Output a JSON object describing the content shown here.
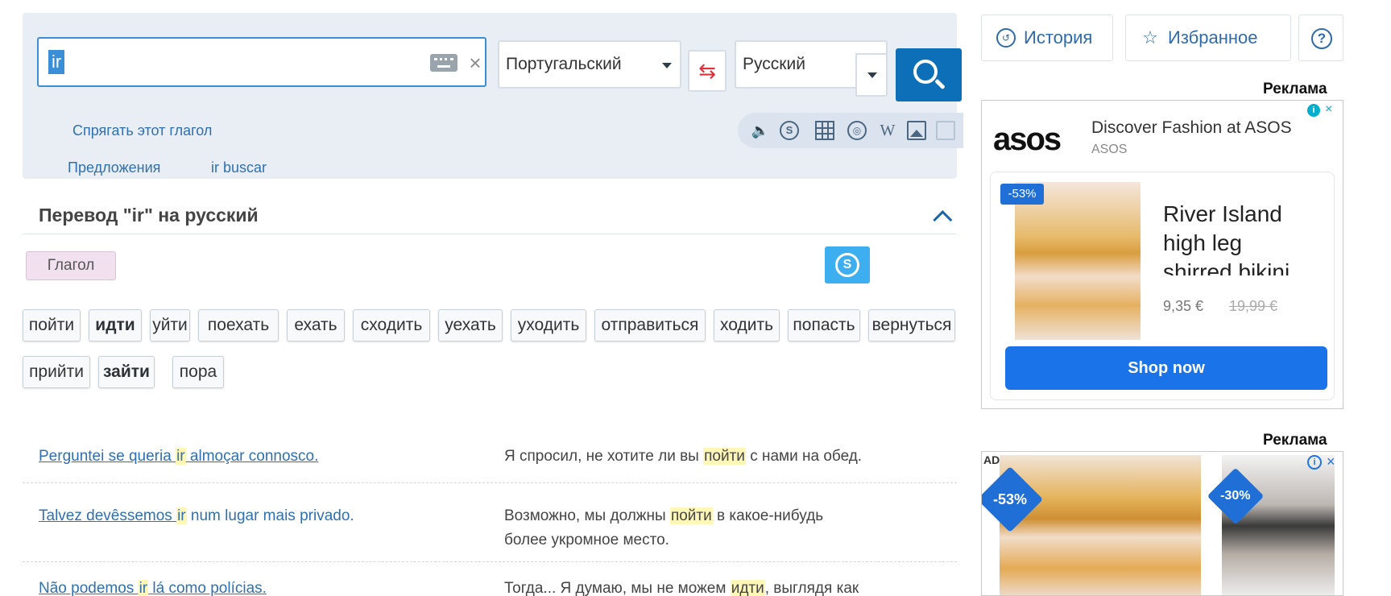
{
  "search": {
    "typed_text": "ir",
    "input_value": "",
    "source_language": "Португальский",
    "target_language": "Русский",
    "conjugate_link": "Спрягать этот глагол",
    "suggestions": [
      "Предложения",
      "ir buscar"
    ]
  },
  "icons": {
    "swap": "⇆",
    "clear": "×",
    "speaker": "🔈",
    "skype": "S",
    "globe": "◎",
    "wiki": "W",
    "history": "↺",
    "favorites": "☆",
    "help": "?"
  },
  "header": {
    "history_label": "История",
    "favorites_label": "Избранное"
  },
  "translation": {
    "title": "Перевод \"ir\" на русский",
    "part_of_speech": "Глагол",
    "words_row1": [
      "пойти",
      "идти",
      "уйти",
      "поехать",
      "ехать",
      "сходить",
      "уехать",
      "уходить",
      "отправиться",
      "ходить",
      "попасть",
      "вернуться"
    ],
    "words_row2": [
      "прийти",
      "зайти",
      "пора"
    ]
  },
  "examples": [
    {
      "pt_before": "Perguntei se queria ",
      "pt_hl": "ir",
      "pt_after": " almoçar connosco.",
      "ru_before": "Я спросил, не хотите ли вы ",
      "ru_hl": "пойти",
      "ru_after": " с нами на обед."
    },
    {
      "pt_before": "Talvez devêssemos ",
      "pt_hl": "ir",
      "pt_after": " num lugar mais privado.",
      "ru_line1_before": "Возможно, мы должны ",
      "ru_hl": "пойти",
      "ru_line1_after": " в какое-нибудь",
      "ru_line2": "более укромное место."
    },
    {
      "pt_before": "Não podemos ",
      "pt_hl": "ir",
      "pt_after": " lá como polícias.",
      "ru_before": "Тогда... Я думаю, мы не можем ",
      "ru_hl": "идти",
      "ru_after": ", выглядя как"
    }
  ],
  "ads": {
    "label": "Реклама",
    "ad1": {
      "logo": "asos",
      "headline": "Discover Fashion at ASOS",
      "brand": "ASOS",
      "discount": "-53%",
      "product_title": "River Island high leg shirred bikini",
      "price_new": "9,35 €",
      "price_old": "19,99 €",
      "cta": "Shop now"
    },
    "ad2": {
      "tag": "AD",
      "discount1": "-53%",
      "discount2": "-30%"
    }
  },
  "colors": {
    "accent": "#0d6fb8",
    "link": "#3070b0",
    "highlight": "#fff7b8",
    "cta": "#1a73e8"
  }
}
